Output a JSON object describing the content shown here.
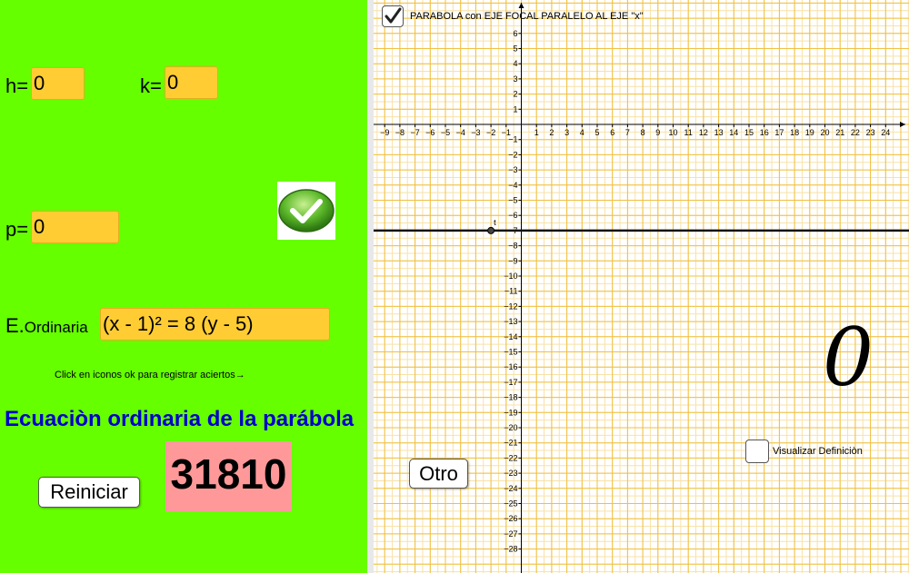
{
  "left": {
    "h_label": "h=",
    "h_value": "0",
    "k_label": "k=",
    "k_value": "0",
    "p_label": "p=",
    "p_value": "0",
    "eq_label_main": "E.",
    "eq_label_sub": "Ordinaria",
    "eq_value": "(x - 1)² = 8 (y - 5)",
    "hint": "Click en iconos ok  para registrar aciertos→",
    "title": "Ecuaciòn ordinaria de la parábola",
    "reset_label": "Reiniciar",
    "score": "31810"
  },
  "graph": {
    "checkbox_label": "PARABOLA con EJE FOCAL PARALELO AL EJE  \"x\"",
    "checkbox_checked": true,
    "other_label": "Otro",
    "big_value": "0",
    "definition_label": "Visualizar Definiciòn",
    "definition_checked": false,
    "point_label": "t",
    "x_ticks": [
      -9,
      -8,
      -7,
      -6,
      -5,
      -4,
      -3,
      -2,
      -1,
      1,
      2,
      3,
      4,
      5,
      6,
      7,
      8,
      9,
      10,
      11,
      12,
      13,
      14,
      15,
      16,
      17,
      18,
      19,
      20,
      21,
      22,
      23,
      24
    ],
    "y_ticks": [
      6,
      5,
      4,
      3,
      2,
      1,
      -1,
      -2,
      -3,
      -4,
      -5,
      -6,
      -7,
      -8,
      -9,
      -10,
      -11,
      -12,
      -13,
      -14,
      -15,
      -16,
      -17,
      -18,
      -19,
      -20,
      -21,
      -22,
      -23,
      -24,
      -25,
      -26,
      -27,
      -28
    ],
    "line_y": -7,
    "point": [
      -2,
      -7
    ],
    "colors": {
      "left_bg": "#66ff00",
      "input_bg": "#ffcc33",
      "grid": "#f0c040",
      "score_bg": "#ff9999",
      "title": "#0000cc"
    }
  }
}
